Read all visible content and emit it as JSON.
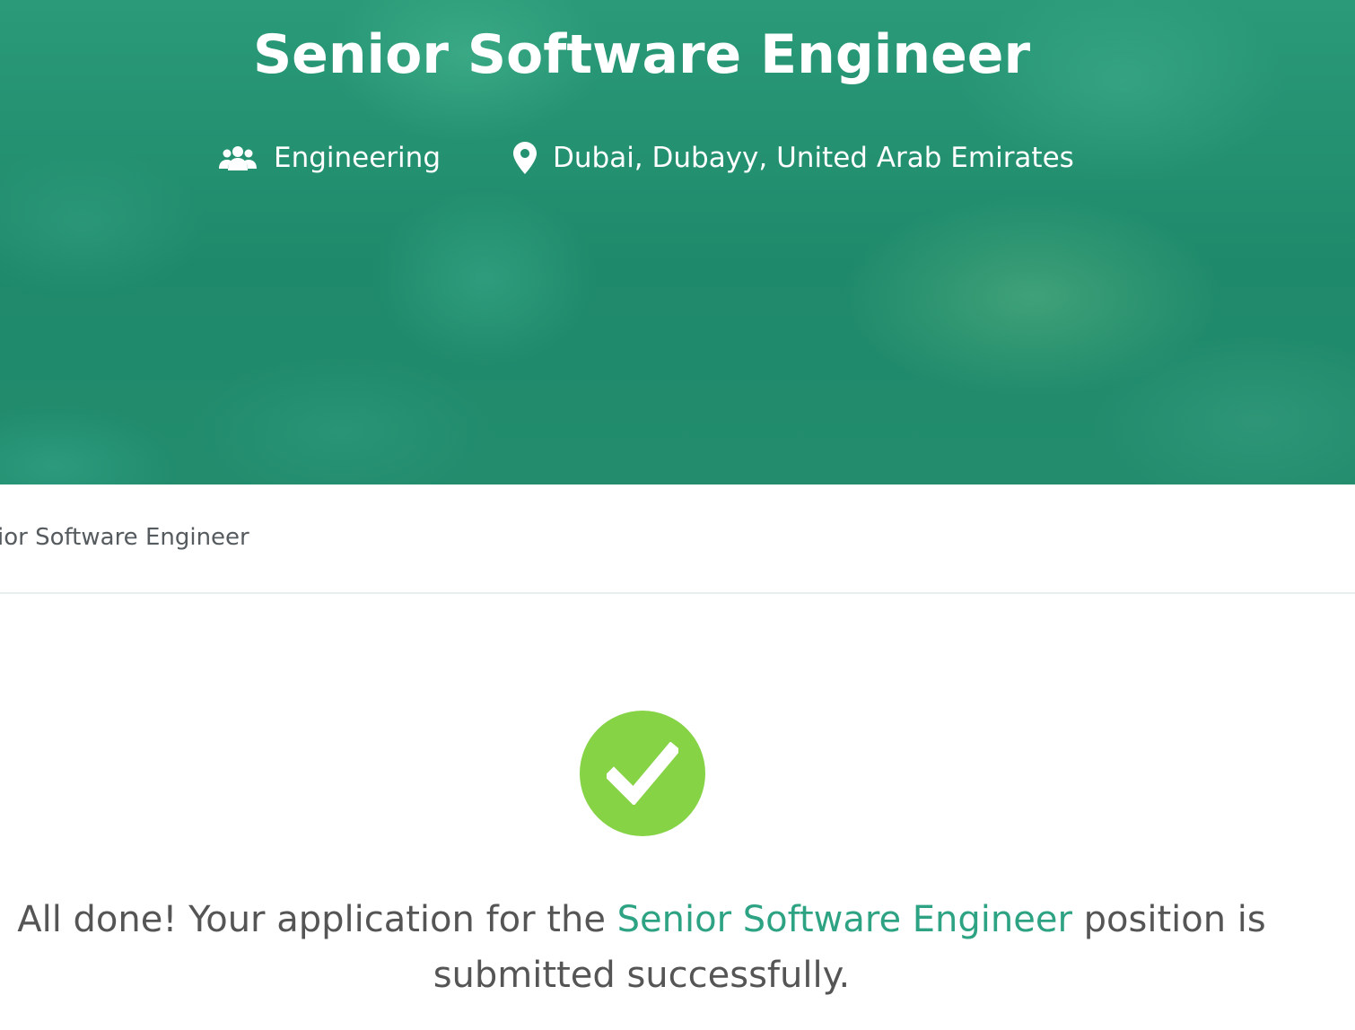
{
  "header": {
    "job_title": "Senior Software Engineer",
    "department": "Engineering",
    "location": "Dubai, Dubayy, United Arab Emirates",
    "icons": {
      "department": "users-icon",
      "location": "map-pin-icon"
    }
  },
  "breadcrumb": {
    "current": "Senior Software Engineer"
  },
  "confirmation": {
    "icon": "checkmark-circle-icon",
    "message_before": "All done! Your application for the ",
    "job_link": "Senior Software Engineer",
    "message_after": " position is submitted successfully."
  },
  "colors": {
    "hero_green": "#23906f",
    "link_teal": "#2ea384",
    "success_green": "#86d346",
    "text_gray": "#555555"
  }
}
